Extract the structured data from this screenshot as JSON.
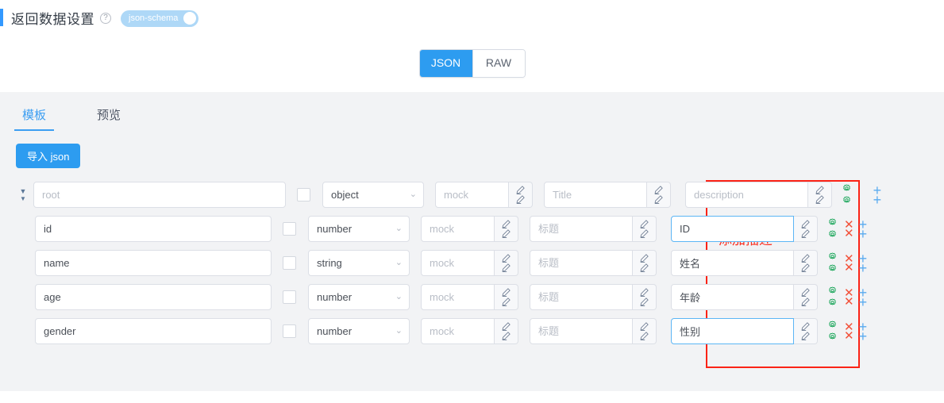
{
  "header": {
    "title": "返回数据设置",
    "help_icon": "question-mark-circle",
    "schema_toggle_label": "json-schema",
    "schema_toggle_on": true,
    "accent_color": "#3399ff"
  },
  "mode_switch": {
    "options": [
      {
        "label": "JSON",
        "active": true
      },
      {
        "label": "RAW",
        "active": false
      }
    ],
    "active_color": "#2d9cf0"
  },
  "tabs": [
    {
      "label": "模板",
      "active": true
    },
    {
      "label": "预览",
      "active": false
    }
  ],
  "toolbar": {
    "import_label": "导入 json"
  },
  "annotation": {
    "text": "添加描述",
    "color": "#fa2d1e"
  },
  "table": {
    "placeholders": {
      "name": "root",
      "mock": "mock",
      "title": "Title",
      "description": "description"
    },
    "rows": [
      {
        "level": 0,
        "has_caret": true,
        "name": "",
        "name_placeholder": "root",
        "required": false,
        "type": "object",
        "mock": "",
        "mock_placeholder": "mock",
        "title": "",
        "title_placeholder": "Title",
        "description": "",
        "description_placeholder": "description",
        "description_focused": false,
        "can_delete": false
      },
      {
        "level": 1,
        "has_caret": false,
        "name": "id",
        "name_placeholder": "",
        "required": false,
        "type": "number",
        "mock": "",
        "mock_placeholder": "mock",
        "title": "",
        "title_placeholder": "标题",
        "description": "ID",
        "description_placeholder": "",
        "description_focused": false,
        "can_delete": true
      },
      {
        "level": 1,
        "has_caret": false,
        "name": "name",
        "name_placeholder": "",
        "required": false,
        "type": "string",
        "mock": "",
        "mock_placeholder": "mock",
        "title": "",
        "title_placeholder": "标题",
        "description": "姓名",
        "description_placeholder": "",
        "description_focused": false,
        "can_delete": true
      },
      {
        "level": 1,
        "has_caret": false,
        "name": "age",
        "name_placeholder": "",
        "required": false,
        "type": "number",
        "mock": "",
        "mock_placeholder": "mock",
        "title": "",
        "title_placeholder": "标题",
        "description": "年龄",
        "description_placeholder": "",
        "description_focused": false,
        "can_delete": true
      },
      {
        "level": 1,
        "has_caret": false,
        "name": "gender",
        "name_placeholder": "",
        "required": false,
        "type": "number",
        "mock": "",
        "mock_placeholder": "mock",
        "title": "",
        "title_placeholder": "标题",
        "description": "性别",
        "description_placeholder": "",
        "description_focused": true,
        "can_delete": true
      }
    ],
    "icons": {
      "gear": "gear-icon",
      "delete": "close-x-icon",
      "add": "plus-icon",
      "edit": "pencil-icon",
      "collapse": "caret-down-icon",
      "dropdown": "chevron-down-icon"
    },
    "colors": {
      "gear": "#18a558",
      "delete": "#f2513a",
      "add": "#5aabf0"
    }
  }
}
